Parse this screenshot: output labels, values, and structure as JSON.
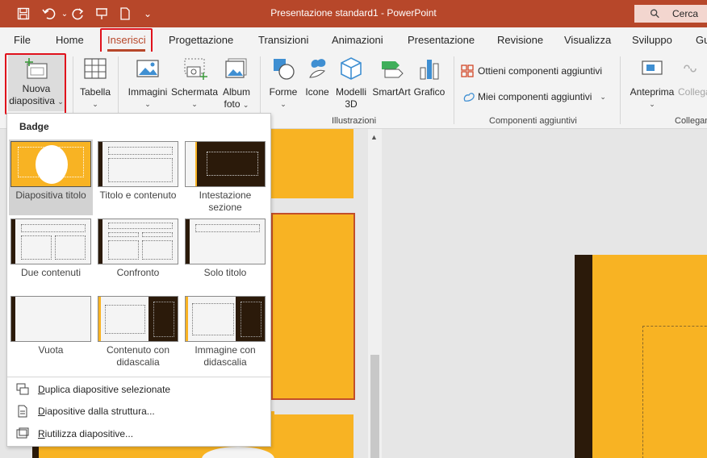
{
  "titlebar": {
    "title": "Presentazione standard1 - PowerPoint",
    "search_label": "Cerca",
    "qa_more": "⌄"
  },
  "tabs": [
    {
      "label": "File"
    },
    {
      "label": "Home"
    },
    {
      "label": "Inserisci",
      "active": true
    },
    {
      "label": "Progettazione"
    },
    {
      "label": "Transizioni"
    },
    {
      "label": "Animazioni"
    },
    {
      "label": "Presentazione"
    },
    {
      "label": "Revisione"
    },
    {
      "label": "Visualizza"
    },
    {
      "label": "Sviluppo"
    },
    {
      "label": "Gu"
    }
  ],
  "ribbon": {
    "new_slide": {
      "line1": "Nuova",
      "line2": "diapositiva"
    },
    "table": {
      "label": "Tabella"
    },
    "images": {
      "label": "Immagini"
    },
    "screenshot": {
      "label": "Schermata"
    },
    "photo_album": {
      "line1": "Album",
      "line2": "foto"
    },
    "shapes": {
      "label": "Forme"
    },
    "icons": {
      "label": "Icone"
    },
    "models3d": {
      "line1": "Modelli",
      "line2": "3D"
    },
    "smartart": {
      "label": "SmartArt"
    },
    "chart": {
      "label": "Grafico"
    },
    "get_addins": {
      "label": "Ottieni componenti aggiuntivi"
    },
    "my_addins": {
      "label": "Miei componenti aggiuntivi"
    },
    "preview": {
      "label": "Anteprima"
    },
    "link": {
      "label": "Collega"
    },
    "groups": {
      "illustrations": "Illustrazioni",
      "addins": "Componenti aggiuntivi",
      "links": "Collegam"
    }
  },
  "dropdown": {
    "header": "Badge",
    "layouts": [
      {
        "line1": "Diapositiva titolo",
        "line2": ""
      },
      {
        "line1": "Titolo e contenuto",
        "line2": ""
      },
      {
        "line1": "Intestazione",
        "line2": "sezione"
      },
      {
        "line1": "Due contenuti",
        "line2": ""
      },
      {
        "line1": "Confronto",
        "line2": ""
      },
      {
        "line1": "Solo titolo",
        "line2": ""
      },
      {
        "line1": "Vuota",
        "line2": ""
      },
      {
        "line1": "Contenuto con",
        "line2": "didascalia"
      },
      {
        "line1": "Immagine con",
        "line2": "didascalia"
      }
    ],
    "items": [
      {
        "pre": "",
        "key": "D",
        "post": "uplica diapositive selezionate"
      },
      {
        "pre": "",
        "key": "D",
        "post": "iapositive dalla struttura..."
      },
      {
        "pre": "",
        "key": "R",
        "post": "iutilizza diapositive..."
      }
    ]
  },
  "colors": {
    "accent": "#b7472a",
    "slide_gold": "#f8b323",
    "slide_dark": "#2b1a0a",
    "highlight_red": "#e0111c"
  }
}
